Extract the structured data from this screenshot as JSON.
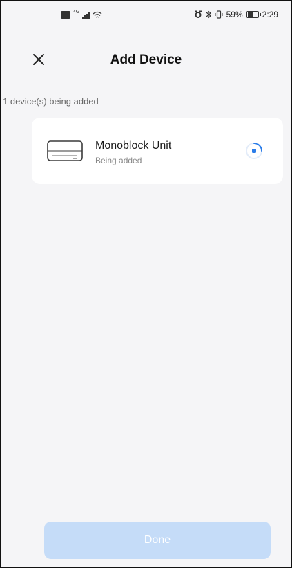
{
  "status_bar": {
    "hd_badge": "HD",
    "network_label": "4G",
    "battery_percent": "59%",
    "battery_level": 0.59,
    "time": "2:29",
    "left_icons": [
      "hd-icon",
      "signal-icon",
      "wifi-icon"
    ],
    "right_icons": [
      "alarm-icon",
      "bluetooth-icon",
      "vibrate-icon",
      "battery-icon"
    ]
  },
  "header": {
    "title": "Add Device",
    "close_icon": "close-icon"
  },
  "subheading": "1 device(s) being added",
  "devices": [
    {
      "name": "Monoblock Unit",
      "status": "Being added",
      "icon": "air-conditioner-icon",
      "progress_icon": "loading-spinner-icon"
    }
  ],
  "done_button": {
    "label": "Done",
    "enabled": false
  },
  "colors": {
    "accent": "#2b7de9",
    "disabled_button": "#c5dcf8",
    "background": "#f5f5f7",
    "card": "#ffffff"
  }
}
